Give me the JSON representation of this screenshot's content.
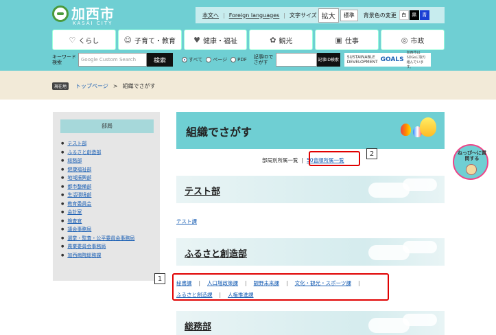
{
  "header": {
    "logo_text": "加西市",
    "logo_sub": "KASAI CITY",
    "util": {
      "skip_link": "本文へ",
      "foreign_link": "Foreign languages",
      "font_size_label": "文字サイズ",
      "font_large": "拡大",
      "font_std": "標準",
      "bg_label": "背景色の変更",
      "bg_white": "白",
      "bg_black": "黒",
      "bg_blue": "青"
    },
    "nav": [
      {
        "label": "くらし",
        "icon": "house-icon",
        "glyph": "♡"
      },
      {
        "label": "子育て・教育",
        "icon": "family-icon",
        "glyph": "☺"
      },
      {
        "label": "健康・福祉",
        "icon": "heart-hand-icon",
        "glyph": "♥"
      },
      {
        "label": "観光",
        "icon": "flower-icon",
        "glyph": "✿"
      },
      {
        "label": "仕事",
        "icon": "briefcase-icon",
        "glyph": "▣"
      },
      {
        "label": "市政",
        "icon": "city-logo-icon",
        "glyph": "◎"
      }
    ],
    "search": {
      "keyword_label": "キーワード検索",
      "placeholder": "Google Custom Search",
      "button": "検索",
      "radio_all": "すべて",
      "radio_page": "ページ",
      "radio_pdf": "PDF",
      "id_label": "記事IDでさがす",
      "id_button": "記事ID検索",
      "sdg_text": "SUSTAINABLE DEVELOPMENT",
      "sdg_goals": "GOALS",
      "sdg_note": "加西市はSDGsに取り組んでいます。"
    }
  },
  "breadcrumb": {
    "here_label": "現在地",
    "top": "トップページ",
    "separator": ">",
    "current": "組織でさがす"
  },
  "sidebar": {
    "title": "部局",
    "items": [
      "テスト部",
      "ふるさと創造部",
      "総務部",
      "健康福祉部",
      "地域振興部",
      "都市整備部",
      "生活環境部",
      "教育委員会",
      "会計室",
      "検査官",
      "議会事務局",
      "選挙・監査・公平委員会事務局",
      "農業委員会事務局",
      "加西病院総務課"
    ]
  },
  "main": {
    "title": "組織でさがす",
    "list_nav": {
      "current": "部局別所属一覧",
      "pipe": "|",
      "link": "50音順所属一覧"
    },
    "sections": [
      {
        "title": "テスト部",
        "links": [
          "テスト課"
        ]
      },
      {
        "title": "ふるさと創造部",
        "links": [
          "秘書課",
          "人口増政策課",
          "観野未来課",
          "文化・観光・スポーツ課",
          "ふるさと創造課",
          "人権推進課"
        ]
      },
      {
        "title": "総務部",
        "links": []
      }
    ]
  },
  "annotations": {
    "callout1": "1",
    "callout2": "2"
  },
  "badge": {
    "text": "ねっぴ〜に質問する"
  },
  "colors": {
    "accent": "#6fcfd3",
    "highlight": "#e00000",
    "link": "#1a5fb4"
  }
}
